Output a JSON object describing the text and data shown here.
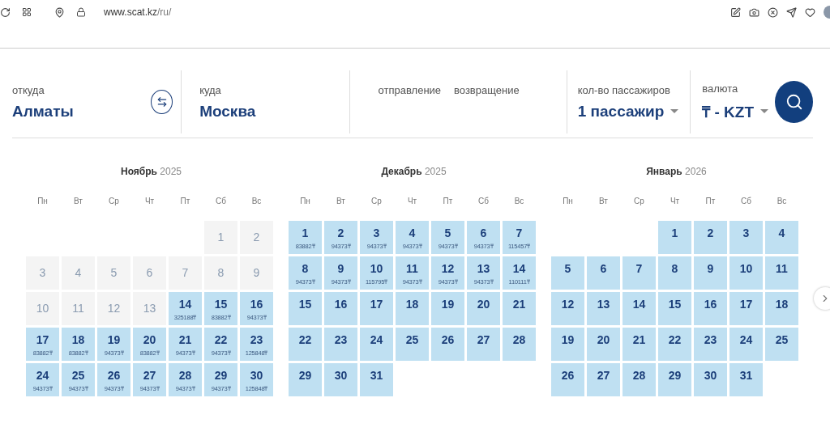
{
  "browser": {
    "url_host": "www.scat.kz",
    "url_path": "/ru/"
  },
  "search": {
    "from": {
      "label": "откуда",
      "value": "Алматы"
    },
    "to": {
      "label": "куда",
      "value": "Москва"
    },
    "depart": {
      "label": "отправление"
    },
    "return": {
      "label": "возвращение"
    },
    "passengers": {
      "label": "кол-во пассажиров",
      "value": "1 пассажир"
    },
    "currency": {
      "label": "валюта",
      "value": "₸ - KZT"
    }
  },
  "months": [
    {
      "name": "Ноябрь",
      "year": "2025",
      "weekdays": [
        "Пн",
        "Вт",
        "Ср",
        "Чт",
        "Пт",
        "Сб",
        "Вс"
      ],
      "days": [
        {
          "kind": "blank"
        },
        {
          "kind": "blank"
        },
        {
          "kind": "blank"
        },
        {
          "kind": "blank"
        },
        {
          "kind": "blank"
        },
        {
          "kind": "day",
          "day": "1",
          "available": false
        },
        {
          "kind": "day",
          "day": "2",
          "available": false
        },
        {
          "kind": "day",
          "day": "3",
          "available": false
        },
        {
          "kind": "day",
          "day": "4",
          "available": false
        },
        {
          "kind": "day",
          "day": "5",
          "available": false
        },
        {
          "kind": "day",
          "day": "6",
          "available": false
        },
        {
          "kind": "day",
          "day": "7",
          "available": false
        },
        {
          "kind": "day",
          "day": "8",
          "available": false
        },
        {
          "kind": "day",
          "day": "9",
          "available": false
        },
        {
          "kind": "day",
          "day": "10",
          "available": false
        },
        {
          "kind": "day",
          "day": "11",
          "available": false
        },
        {
          "kind": "day",
          "day": "12",
          "available": false
        },
        {
          "kind": "day",
          "day": "13",
          "available": false
        },
        {
          "kind": "day",
          "day": "14",
          "available": true,
          "price": "325188₸"
        },
        {
          "kind": "day",
          "day": "15",
          "available": true,
          "price": "83882₸"
        },
        {
          "kind": "day",
          "day": "16",
          "available": true,
          "price": "94373₸"
        },
        {
          "kind": "day",
          "day": "17",
          "available": true,
          "price": "83882₸"
        },
        {
          "kind": "day",
          "day": "18",
          "available": true,
          "price": "83882₸"
        },
        {
          "kind": "day",
          "day": "19",
          "available": true,
          "price": "94373₸"
        },
        {
          "kind": "day",
          "day": "20",
          "available": true,
          "price": "83882₸"
        },
        {
          "kind": "day",
          "day": "21",
          "available": true,
          "price": "94373₸"
        },
        {
          "kind": "day",
          "day": "22",
          "available": true,
          "price": "94373₸"
        },
        {
          "kind": "day",
          "day": "23",
          "available": true,
          "price": "125848₸"
        },
        {
          "kind": "day",
          "day": "24",
          "available": true,
          "price": "94373₸"
        },
        {
          "kind": "day",
          "day": "25",
          "available": true,
          "price": "94373₸"
        },
        {
          "kind": "day",
          "day": "26",
          "available": true,
          "price": "94373₸"
        },
        {
          "kind": "day",
          "day": "27",
          "available": true,
          "price": "94373₸"
        },
        {
          "kind": "day",
          "day": "28",
          "available": true,
          "price": "94373₸"
        },
        {
          "kind": "day",
          "day": "29",
          "available": true,
          "price": "94373₸"
        },
        {
          "kind": "day",
          "day": "30",
          "available": true,
          "price": "125848₸"
        }
      ]
    },
    {
      "name": "Декабрь",
      "year": "2025",
      "weekdays": [
        "Пн",
        "Вт",
        "Ср",
        "Чт",
        "Пт",
        "Сб",
        "Вс"
      ],
      "days": [
        {
          "kind": "day",
          "day": "1",
          "available": true,
          "price": "83882₸"
        },
        {
          "kind": "day",
          "day": "2",
          "available": true,
          "price": "94373₸"
        },
        {
          "kind": "day",
          "day": "3",
          "available": true,
          "price": "94373₸"
        },
        {
          "kind": "day",
          "day": "4",
          "available": true,
          "price": "94373₸"
        },
        {
          "kind": "day",
          "day": "5",
          "available": true,
          "price": "94373₸"
        },
        {
          "kind": "day",
          "day": "6",
          "available": true,
          "price": "94373₸"
        },
        {
          "kind": "day",
          "day": "7",
          "available": true,
          "price": "115457₸"
        },
        {
          "kind": "day",
          "day": "8",
          "available": true,
          "price": "94373₸"
        },
        {
          "kind": "day",
          "day": "9",
          "available": true,
          "price": "94373₸"
        },
        {
          "kind": "day",
          "day": "10",
          "available": true,
          "price": "115795₸"
        },
        {
          "kind": "day",
          "day": "11",
          "available": true,
          "price": "94373₸"
        },
        {
          "kind": "day",
          "day": "12",
          "available": true,
          "price": "94373₸"
        },
        {
          "kind": "day",
          "day": "13",
          "available": true,
          "price": "94373₸"
        },
        {
          "kind": "day",
          "day": "14",
          "available": true,
          "price": "110111₸"
        },
        {
          "kind": "day",
          "day": "15",
          "available": true
        },
        {
          "kind": "day",
          "day": "16",
          "available": true
        },
        {
          "kind": "day",
          "day": "17",
          "available": true
        },
        {
          "kind": "day",
          "day": "18",
          "available": true
        },
        {
          "kind": "day",
          "day": "19",
          "available": true
        },
        {
          "kind": "day",
          "day": "20",
          "available": true
        },
        {
          "kind": "day",
          "day": "21",
          "available": true
        },
        {
          "kind": "day",
          "day": "22",
          "available": true
        },
        {
          "kind": "day",
          "day": "23",
          "available": true
        },
        {
          "kind": "day",
          "day": "24",
          "available": true
        },
        {
          "kind": "day",
          "day": "25",
          "available": true
        },
        {
          "kind": "day",
          "day": "26",
          "available": true
        },
        {
          "kind": "day",
          "day": "27",
          "available": true
        },
        {
          "kind": "day",
          "day": "28",
          "available": true
        },
        {
          "kind": "day",
          "day": "29",
          "available": true
        },
        {
          "kind": "day",
          "day": "30",
          "available": true
        },
        {
          "kind": "day",
          "day": "31",
          "available": true
        }
      ]
    },
    {
      "name": "Январь",
      "year": "2026",
      "weekdays": [
        "Пн",
        "Вт",
        "Ср",
        "Чт",
        "Пт",
        "Сб",
        "Вс"
      ],
      "days": [
        {
          "kind": "blank"
        },
        {
          "kind": "blank"
        },
        {
          "kind": "blank"
        },
        {
          "kind": "day",
          "day": "1",
          "available": true
        },
        {
          "kind": "day",
          "day": "2",
          "available": true
        },
        {
          "kind": "day",
          "day": "3",
          "available": true
        },
        {
          "kind": "day",
          "day": "4",
          "available": true
        },
        {
          "kind": "day",
          "day": "5",
          "available": true
        },
        {
          "kind": "day",
          "day": "6",
          "available": true
        },
        {
          "kind": "day",
          "day": "7",
          "available": true
        },
        {
          "kind": "day",
          "day": "8",
          "available": true
        },
        {
          "kind": "day",
          "day": "9",
          "available": true
        },
        {
          "kind": "day",
          "day": "10",
          "available": true
        },
        {
          "kind": "day",
          "day": "11",
          "available": true
        },
        {
          "kind": "day",
          "day": "12",
          "available": true
        },
        {
          "kind": "day",
          "day": "13",
          "available": true
        },
        {
          "kind": "day",
          "day": "14",
          "available": true
        },
        {
          "kind": "day",
          "day": "15",
          "available": true
        },
        {
          "kind": "day",
          "day": "16",
          "available": true
        },
        {
          "kind": "day",
          "day": "17",
          "available": true
        },
        {
          "kind": "day",
          "day": "18",
          "available": true
        },
        {
          "kind": "day",
          "day": "19",
          "available": true
        },
        {
          "kind": "day",
          "day": "20",
          "available": true
        },
        {
          "kind": "day",
          "day": "21",
          "available": true
        },
        {
          "kind": "day",
          "day": "22",
          "available": true
        },
        {
          "kind": "day",
          "day": "23",
          "available": true
        },
        {
          "kind": "day",
          "day": "24",
          "available": true
        },
        {
          "kind": "day",
          "day": "25",
          "available": true
        },
        {
          "kind": "day",
          "day": "26",
          "available": true
        },
        {
          "kind": "day",
          "day": "27",
          "available": true
        },
        {
          "kind": "day",
          "day": "28",
          "available": true
        },
        {
          "kind": "day",
          "day": "29",
          "available": true
        },
        {
          "kind": "day",
          "day": "30",
          "available": true
        },
        {
          "kind": "day",
          "day": "31",
          "available": true
        }
      ]
    }
  ]
}
